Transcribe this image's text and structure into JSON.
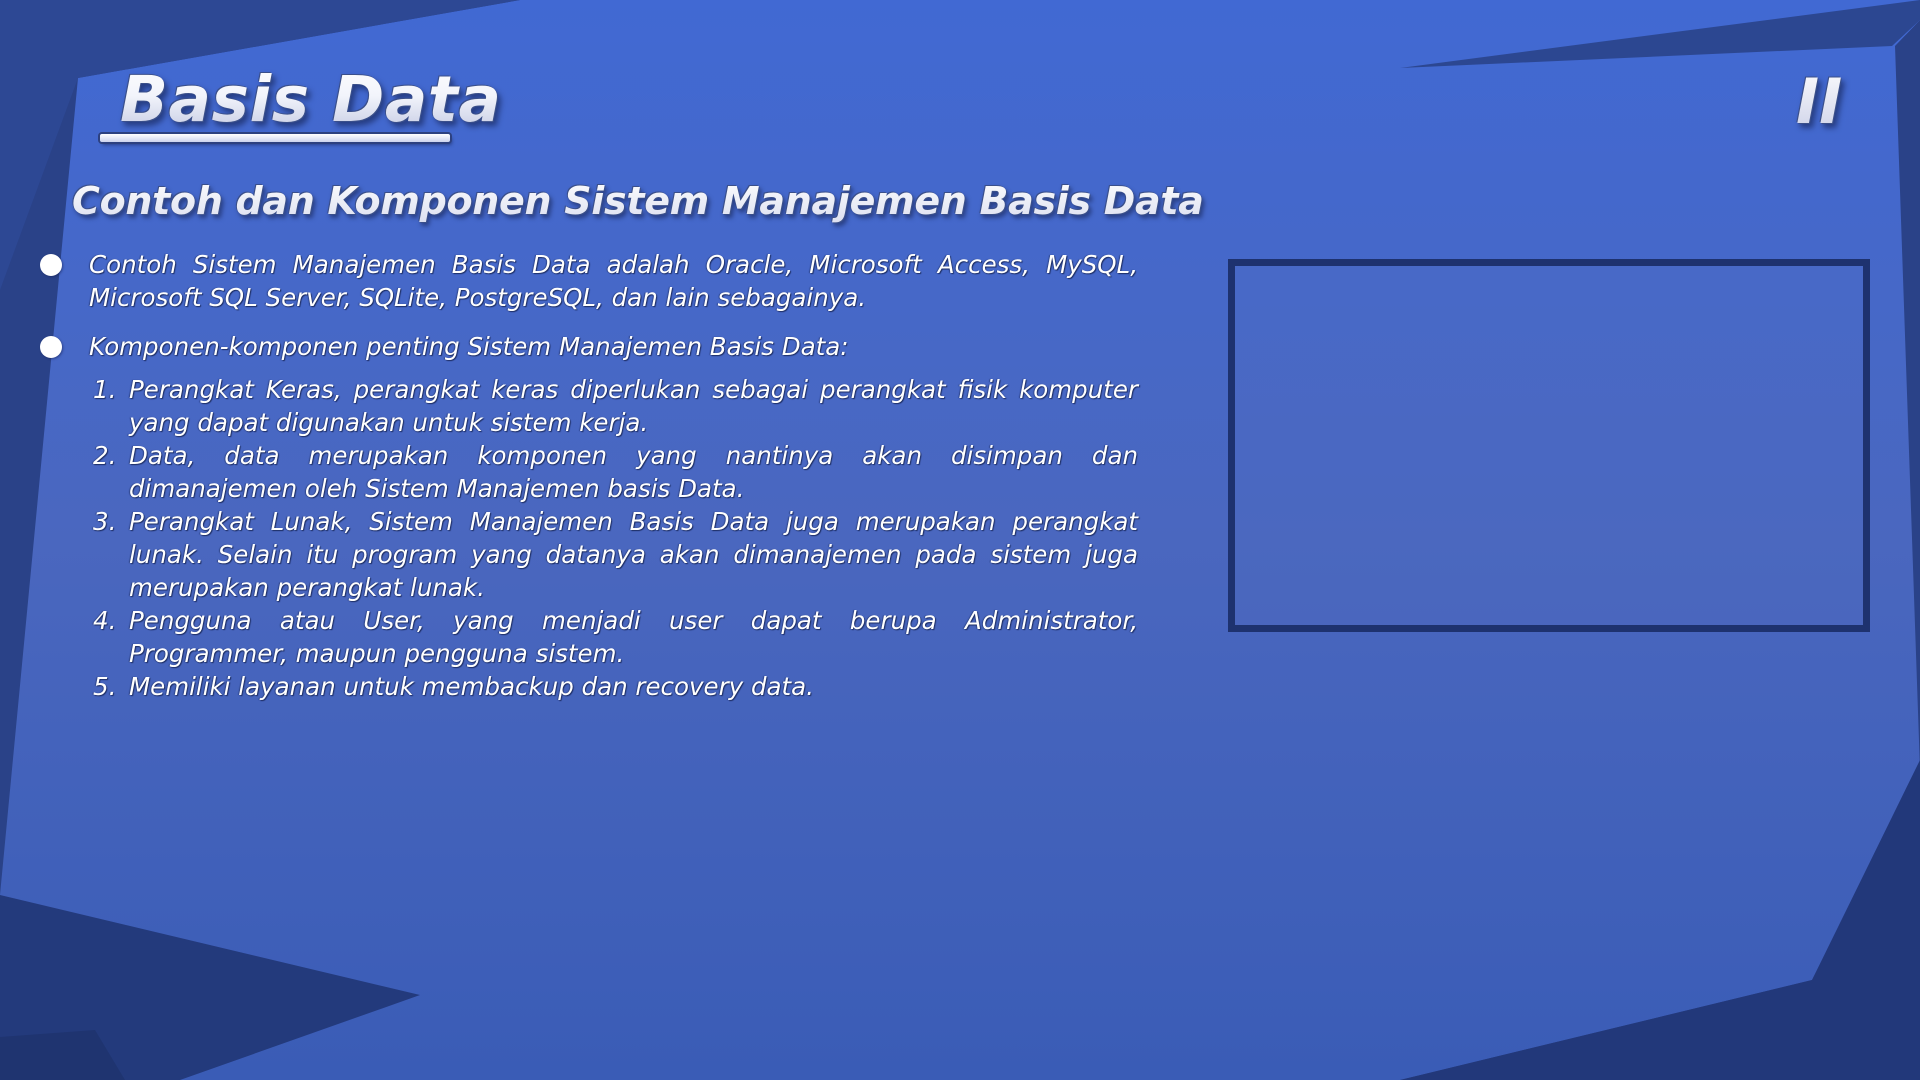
{
  "slide": {
    "title": "Basis Data",
    "section_number": "II",
    "subtitle": "Contoh dan Komponen Sistem Manajemen Basis Data",
    "bullets": [
      {
        "text": "Contoh Sistem Manajemen Basis Data adalah Oracle, Microsoft Access, MySQL, Microsoft SQL Server, SQLite, PostgreSQL, dan lain sebagainya."
      },
      {
        "text": "Komponen-komponen penting Sistem Manajemen Basis Data:",
        "items": [
          {
            "num": "1.",
            "text": "Perangkat Keras, perangkat keras diperlukan sebagai perangkat fisik komputer yang dapat digunakan untuk sistem kerja."
          },
          {
            "num": "2.",
            "text": "Data, data merupakan komponen yang nantinya akan disimpan dan dimanajemen oleh Sistem Manajemen basis Data."
          },
          {
            "num": "3.",
            "text": "Perangkat Lunak, Sistem Manajemen Basis Data juga merupakan perangkat lunak. Selain itu program yang datanya akan dimanajemen pada sistem juga merupakan perangkat lunak."
          },
          {
            "num": "4.",
            "text": "Pengguna atau User, yang menjadi user dapat berupa Administrator, Programmer, maupun pengguna sistem."
          },
          {
            "num": "5.",
            "text": "Memiliki layanan untuk membackup dan recovery data."
          }
        ]
      }
    ]
  },
  "colors": {
    "background_top": "#3d69d6",
    "background_bottom": "#2c4791",
    "shape_dark": "#2a4288",
    "frame_border": "#1e326f",
    "text": "#ffffff"
  }
}
